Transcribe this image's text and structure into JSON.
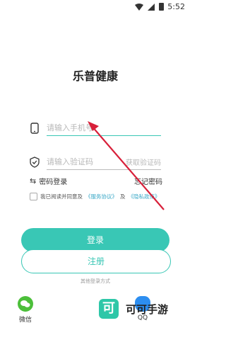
{
  "status_bar": {
    "time": "5:52"
  },
  "app": {
    "title": "乐普健康"
  },
  "phone_field": {
    "placeholder": "请输入手机号"
  },
  "code_field": {
    "placeholder": "请输入验证码",
    "get_code_label": "获取验证码"
  },
  "options": {
    "password_login": "密码登录",
    "forgot_password": "忘记密码"
  },
  "agreement": {
    "text_prefix": "我已阅读并同意及",
    "service_link": "《服务协议》",
    "joiner": "及",
    "privacy_link": "《隐私政策》"
  },
  "buttons": {
    "login": "登录",
    "register": "注册"
  },
  "other_login": {
    "label": "其他登录方式"
  },
  "social": {
    "wechat": "微信",
    "qq": "QQ"
  },
  "watermark": {
    "logo_char": "可",
    "text": "可可手游"
  },
  "colors": {
    "accent": "#39c7b5",
    "arrow": "#d8203a"
  }
}
